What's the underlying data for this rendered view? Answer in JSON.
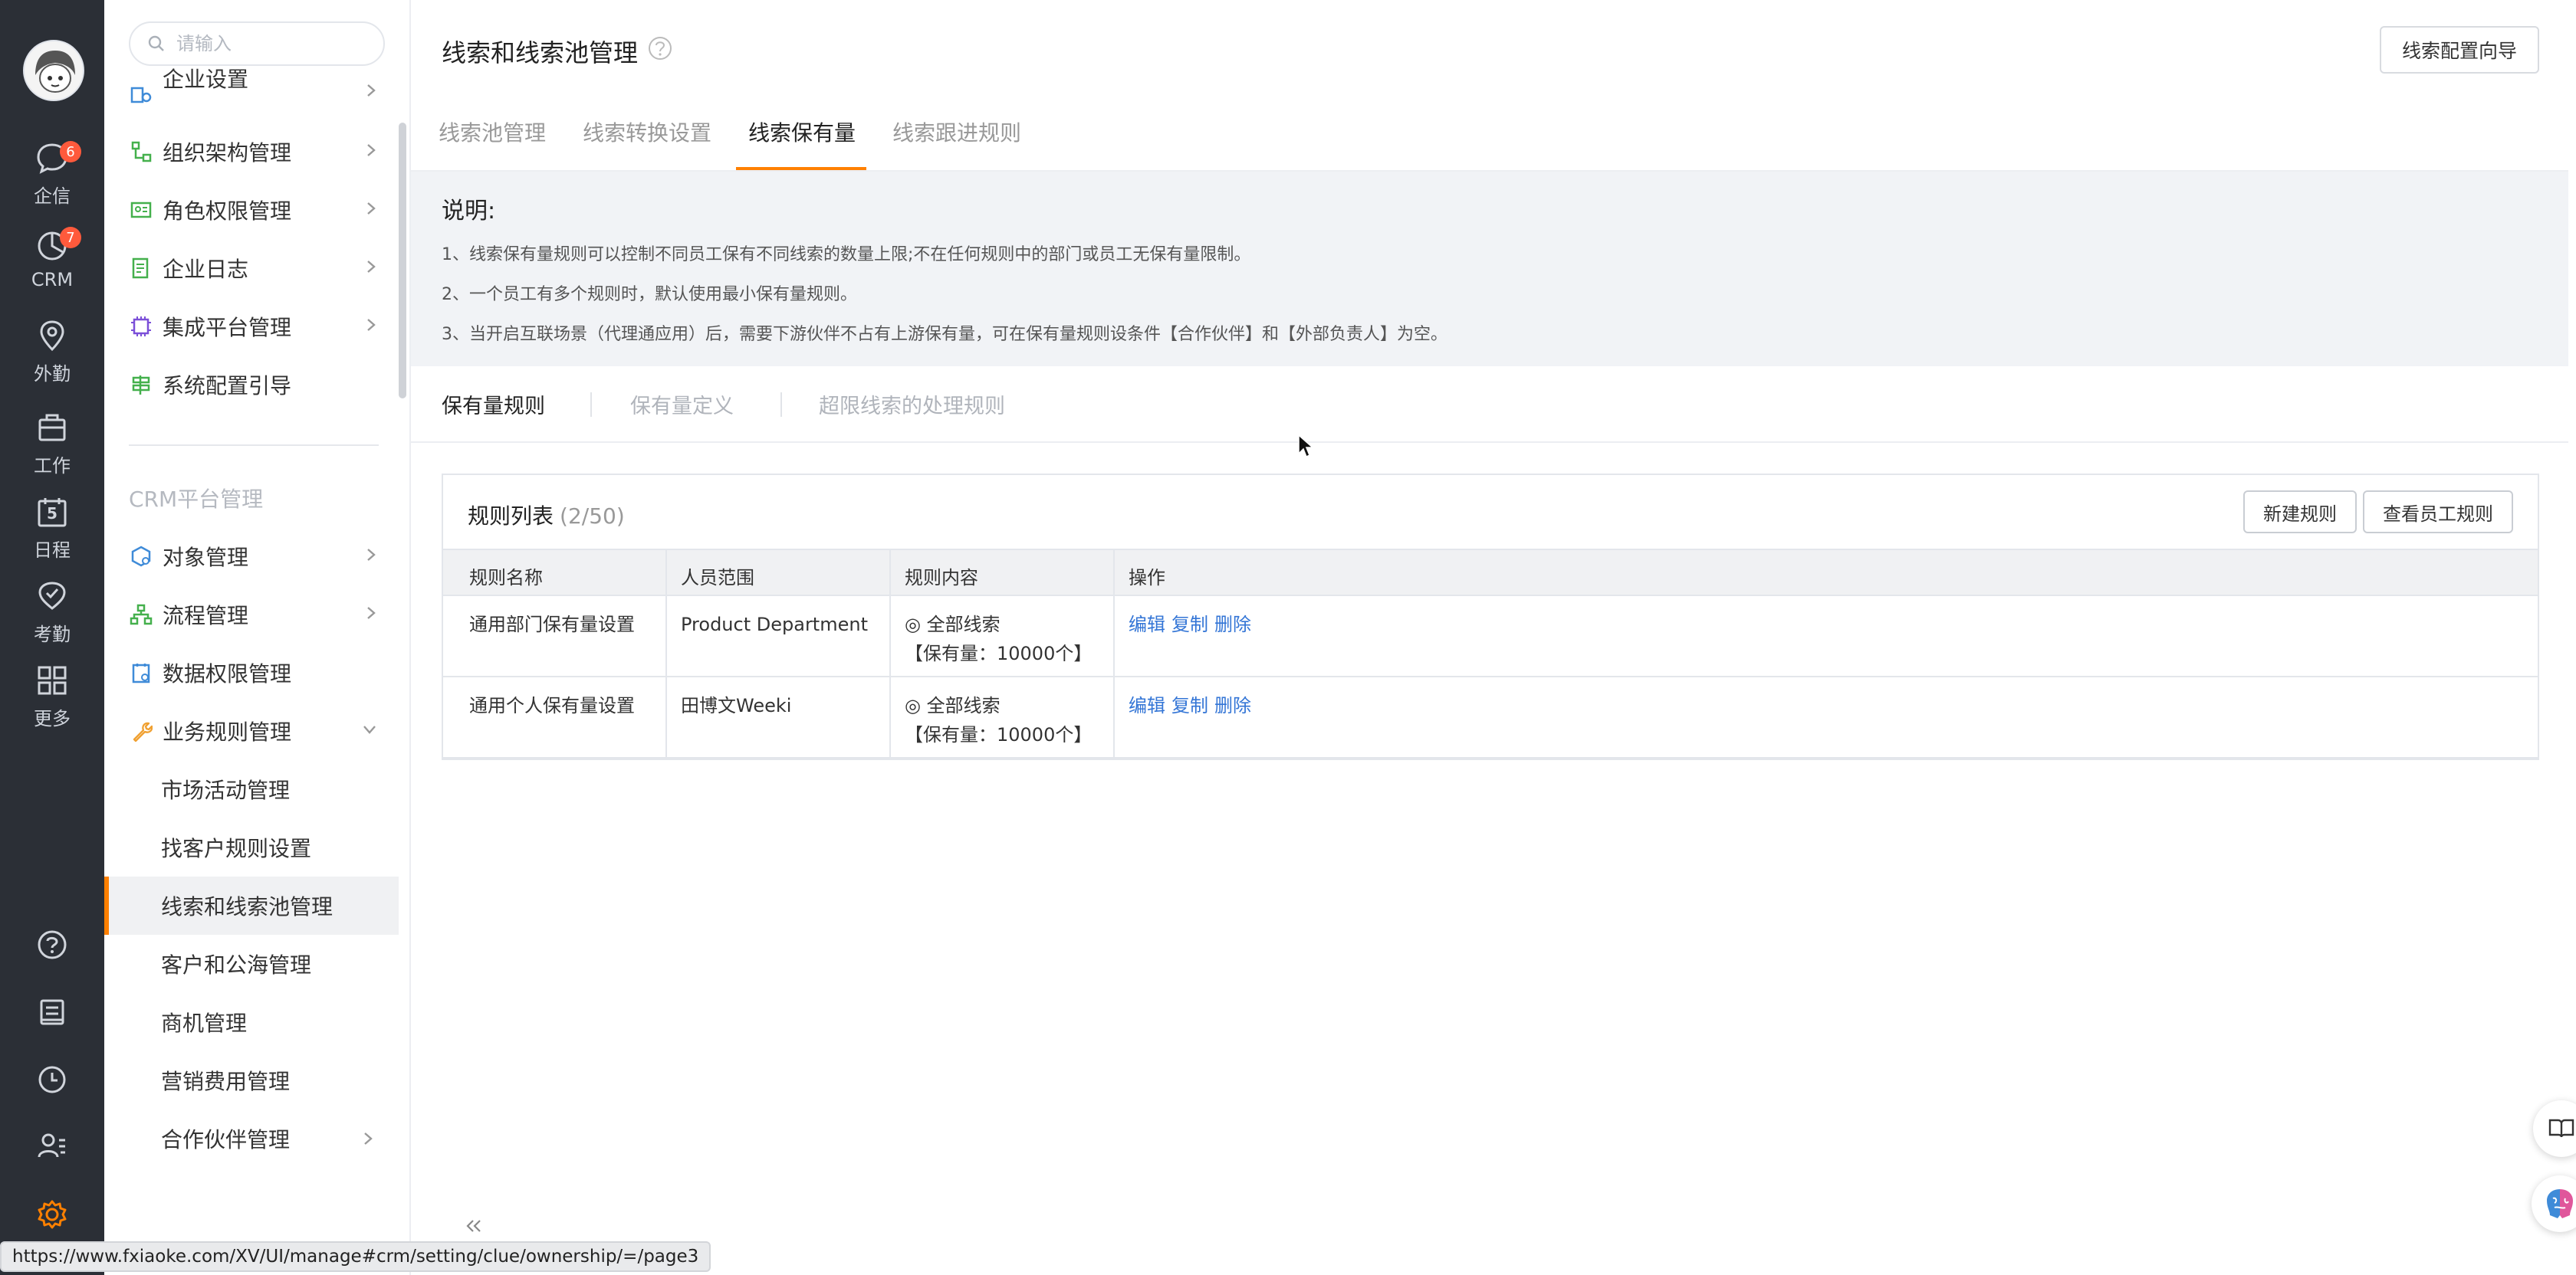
{
  "colors": {
    "accent": "#ff8000",
    "rail_bg": "#2b2f36",
    "link": "#3375d6",
    "badge": "#ff5a3c"
  },
  "rail": {
    "items": [
      {
        "label": "企信",
        "icon": "chat-icon",
        "badge": "6"
      },
      {
        "label": "CRM",
        "icon": "pie-chart-icon",
        "badge": "7"
      },
      {
        "label": "外勤",
        "icon": "location-pin-icon"
      },
      {
        "label": "工作",
        "icon": "briefcase-icon"
      },
      {
        "label": "日程",
        "icon": "calendar-icon",
        "day": "5"
      },
      {
        "label": "考勤",
        "icon": "check-circle-icon"
      },
      {
        "label": "更多",
        "icon": "grid-icon"
      }
    ],
    "bottom_icons": [
      "help-icon",
      "notebook-icon",
      "clock-icon",
      "contacts-icon",
      "settings-gear-icon"
    ]
  },
  "sidebar": {
    "search_placeholder": "请输入",
    "menu": [
      {
        "label": "企业设置",
        "icon": "company-settings-icon"
      },
      {
        "label": "组织架构管理",
        "icon": "org-tree-icon"
      },
      {
        "label": "角色权限管理",
        "icon": "id-card-icon"
      },
      {
        "label": "企业日志",
        "icon": "log-icon"
      },
      {
        "label": "集成平台管理",
        "icon": "chip-icon"
      },
      {
        "label": "系统配置引导",
        "icon": "signpost-icon"
      }
    ],
    "group_title": "CRM平台管理",
    "crm_menu": [
      {
        "label": "对象管理",
        "icon": "object-icon"
      },
      {
        "label": "流程管理",
        "icon": "flow-icon"
      },
      {
        "label": "数据权限管理",
        "icon": "data-permission-icon"
      },
      {
        "label": "业务规则管理",
        "icon": "wrench-icon"
      }
    ],
    "submenu": [
      "市场活动管理",
      "找客户规则设置",
      "线索和线索池管理",
      "客户和公海管理",
      "商机管理",
      "营销费用管理",
      "合作伙伴管理"
    ],
    "active_submenu": "线索和线索池管理"
  },
  "header": {
    "title": "线索和线索池管理",
    "wizard_button": "线索配置向导"
  },
  "tabs": [
    "线索池管理",
    "线索转换设置",
    "线索保有量",
    "线索跟进规则"
  ],
  "active_tab": "线索保有量",
  "notes": {
    "title": "说明:",
    "lines": [
      "1、线索保有量规则可以控制不同员工保有不同线索的数量上限;不在任何规则中的部门或员工无保有量限制。",
      "2、一个员工有多个规则时，默认使用最小保有量规则。",
      "3、当开启互联场景（代理通应用）后，需要下游伙伴不占有上游保有量，可在保有量规则设条件【合作伙伴】和【外部负责人】为空。"
    ]
  },
  "subtabs": [
    "保有量规则",
    "保有量定义",
    "超限线索的处理规则"
  ],
  "active_subtab": "保有量规则",
  "rules_panel": {
    "title": "规则列表",
    "count": "(2/50)",
    "new_button": "新建规则",
    "view_button": "查看员工规则",
    "columns": [
      "规则名称",
      "人员范围",
      "规则内容",
      "操作"
    ],
    "rows": [
      {
        "name": "通用部门保有量设置",
        "scope": "Product Department",
        "content_line1": "◎ 全部线索",
        "content_line2": "【保有量：10000个】",
        "actions": [
          "编辑",
          "复制",
          "删除"
        ]
      },
      {
        "name": "通用个人保有量设置",
        "scope": "田博文Weeki",
        "content_line1": "◎ 全部线索",
        "content_line2": "【保有量：10000个】",
        "actions": [
          "编辑",
          "复制",
          "删除"
        ]
      }
    ]
  },
  "status_url": "https://www.fxiaoke.com/XV/UI/manage#crm/setting/clue/ownership/=/page3"
}
